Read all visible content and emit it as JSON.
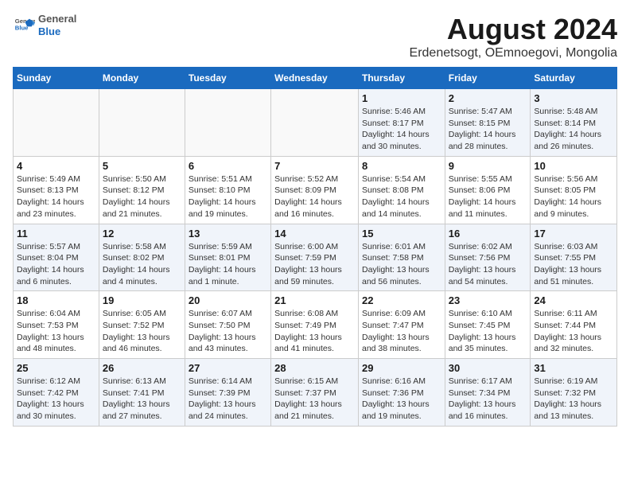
{
  "header": {
    "logo_general": "General",
    "logo_blue": "Blue",
    "title": "August 2024",
    "subtitle": "Erdenetsogt, OEmnoegovi, Mongolia"
  },
  "days_of_week": [
    "Sunday",
    "Monday",
    "Tuesday",
    "Wednesday",
    "Thursday",
    "Friday",
    "Saturday"
  ],
  "weeks": [
    [
      {
        "day": "",
        "info": ""
      },
      {
        "day": "",
        "info": ""
      },
      {
        "day": "",
        "info": ""
      },
      {
        "day": "",
        "info": ""
      },
      {
        "day": "1",
        "info": "Sunrise: 5:46 AM\nSunset: 8:17 PM\nDaylight: 14 hours\nand 30 minutes."
      },
      {
        "day": "2",
        "info": "Sunrise: 5:47 AM\nSunset: 8:15 PM\nDaylight: 14 hours\nand 28 minutes."
      },
      {
        "day": "3",
        "info": "Sunrise: 5:48 AM\nSunset: 8:14 PM\nDaylight: 14 hours\nand 26 minutes."
      }
    ],
    [
      {
        "day": "4",
        "info": "Sunrise: 5:49 AM\nSunset: 8:13 PM\nDaylight: 14 hours\nand 23 minutes."
      },
      {
        "day": "5",
        "info": "Sunrise: 5:50 AM\nSunset: 8:12 PM\nDaylight: 14 hours\nand 21 minutes."
      },
      {
        "day": "6",
        "info": "Sunrise: 5:51 AM\nSunset: 8:10 PM\nDaylight: 14 hours\nand 19 minutes."
      },
      {
        "day": "7",
        "info": "Sunrise: 5:52 AM\nSunset: 8:09 PM\nDaylight: 14 hours\nand 16 minutes."
      },
      {
        "day": "8",
        "info": "Sunrise: 5:54 AM\nSunset: 8:08 PM\nDaylight: 14 hours\nand 14 minutes."
      },
      {
        "day": "9",
        "info": "Sunrise: 5:55 AM\nSunset: 8:06 PM\nDaylight: 14 hours\nand 11 minutes."
      },
      {
        "day": "10",
        "info": "Sunrise: 5:56 AM\nSunset: 8:05 PM\nDaylight: 14 hours\nand 9 minutes."
      }
    ],
    [
      {
        "day": "11",
        "info": "Sunrise: 5:57 AM\nSunset: 8:04 PM\nDaylight: 14 hours\nand 6 minutes."
      },
      {
        "day": "12",
        "info": "Sunrise: 5:58 AM\nSunset: 8:02 PM\nDaylight: 14 hours\nand 4 minutes."
      },
      {
        "day": "13",
        "info": "Sunrise: 5:59 AM\nSunset: 8:01 PM\nDaylight: 14 hours\nand 1 minute."
      },
      {
        "day": "14",
        "info": "Sunrise: 6:00 AM\nSunset: 7:59 PM\nDaylight: 13 hours\nand 59 minutes."
      },
      {
        "day": "15",
        "info": "Sunrise: 6:01 AM\nSunset: 7:58 PM\nDaylight: 13 hours\nand 56 minutes."
      },
      {
        "day": "16",
        "info": "Sunrise: 6:02 AM\nSunset: 7:56 PM\nDaylight: 13 hours\nand 54 minutes."
      },
      {
        "day": "17",
        "info": "Sunrise: 6:03 AM\nSunset: 7:55 PM\nDaylight: 13 hours\nand 51 minutes."
      }
    ],
    [
      {
        "day": "18",
        "info": "Sunrise: 6:04 AM\nSunset: 7:53 PM\nDaylight: 13 hours\nand 48 minutes."
      },
      {
        "day": "19",
        "info": "Sunrise: 6:05 AM\nSunset: 7:52 PM\nDaylight: 13 hours\nand 46 minutes."
      },
      {
        "day": "20",
        "info": "Sunrise: 6:07 AM\nSunset: 7:50 PM\nDaylight: 13 hours\nand 43 minutes."
      },
      {
        "day": "21",
        "info": "Sunrise: 6:08 AM\nSunset: 7:49 PM\nDaylight: 13 hours\nand 41 minutes."
      },
      {
        "day": "22",
        "info": "Sunrise: 6:09 AM\nSunset: 7:47 PM\nDaylight: 13 hours\nand 38 minutes."
      },
      {
        "day": "23",
        "info": "Sunrise: 6:10 AM\nSunset: 7:45 PM\nDaylight: 13 hours\nand 35 minutes."
      },
      {
        "day": "24",
        "info": "Sunrise: 6:11 AM\nSunset: 7:44 PM\nDaylight: 13 hours\nand 32 minutes."
      }
    ],
    [
      {
        "day": "25",
        "info": "Sunrise: 6:12 AM\nSunset: 7:42 PM\nDaylight: 13 hours\nand 30 minutes."
      },
      {
        "day": "26",
        "info": "Sunrise: 6:13 AM\nSunset: 7:41 PM\nDaylight: 13 hours\nand 27 minutes."
      },
      {
        "day": "27",
        "info": "Sunrise: 6:14 AM\nSunset: 7:39 PM\nDaylight: 13 hours\nand 24 minutes."
      },
      {
        "day": "28",
        "info": "Sunrise: 6:15 AM\nSunset: 7:37 PM\nDaylight: 13 hours\nand 21 minutes."
      },
      {
        "day": "29",
        "info": "Sunrise: 6:16 AM\nSunset: 7:36 PM\nDaylight: 13 hours\nand 19 minutes."
      },
      {
        "day": "30",
        "info": "Sunrise: 6:17 AM\nSunset: 7:34 PM\nDaylight: 13 hours\nand 16 minutes."
      },
      {
        "day": "31",
        "info": "Sunrise: 6:19 AM\nSunset: 7:32 PM\nDaylight: 13 hours\nand 13 minutes."
      }
    ]
  ]
}
